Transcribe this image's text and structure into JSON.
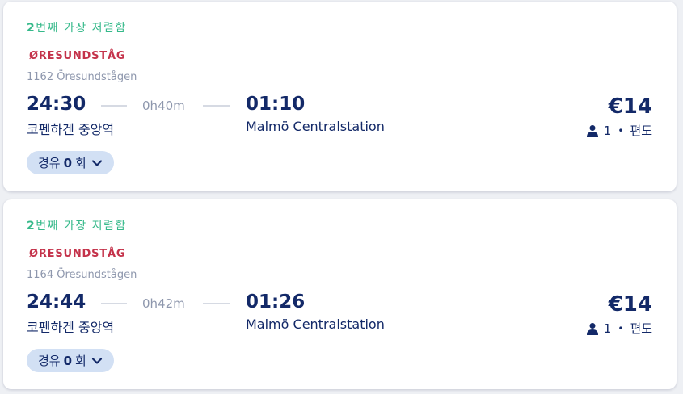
{
  "trips": [
    {
      "badge_num": "2",
      "badge_text": "번째 가장 저렴함",
      "operator_logo": "ØRESUNDSTÅG",
      "train": "1162 Öresundstågen",
      "departure_time": "24:30",
      "duration": "0h40m",
      "arrival_time": "01:10",
      "departure_station": "코펜하겐 중앙역",
      "arrival_station": "Malmö Centralstation",
      "price": "€14",
      "passengers": "1",
      "trip_type": "편도",
      "stops_label": "경유",
      "stops_count": "0",
      "stops_unit": "회"
    },
    {
      "badge_num": "2",
      "badge_text": "번째 가장 저렴함",
      "operator_logo": "ØRESUNDSTÅG",
      "train": "1164 Öresundstågen",
      "departure_time": "24:44",
      "duration": "0h42m",
      "arrival_time": "01:26",
      "departure_station": "코펜하겐 중앙역",
      "arrival_station": "Malmö Centralstation",
      "price": "€14",
      "passengers": "1",
      "trip_type": "편도",
      "stops_label": "경유",
      "stops_count": "0",
      "stops_unit": "회"
    }
  ],
  "colors": {
    "badge": "#35b98a",
    "logo": "#c4324a",
    "text_primary": "#132968",
    "text_muted": "#8e97ad",
    "stops_pill": "#d2e0f4"
  },
  "icons": {
    "passenger": "person-icon",
    "expand": "chevron-down-icon",
    "separator": "•"
  }
}
